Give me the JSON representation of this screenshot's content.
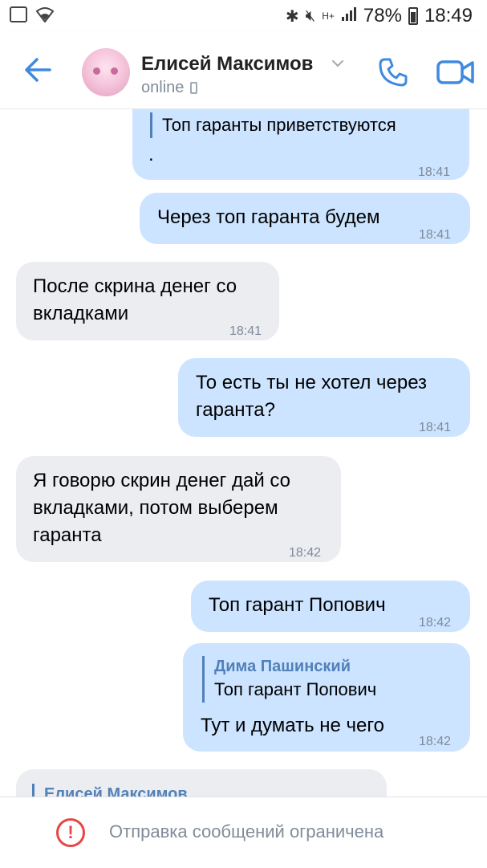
{
  "status_bar": {
    "battery": "78%",
    "time": "18:49",
    "signal": "H+"
  },
  "header": {
    "name": "Елисей Максимов",
    "status": "online"
  },
  "messages": [
    {
      "dir": "out",
      "quote_text": "Топ гаранты приветствуются",
      "text": ".",
      "time": "18:41"
    },
    {
      "dir": "out",
      "text": "Через топ гаранта будем",
      "time": "18:41"
    },
    {
      "dir": "in",
      "line1": "После скрина денег со",
      "line2": "вкладками",
      "time": "18:41"
    },
    {
      "dir": "out",
      "line1": "То есть ты не хотел через",
      "line2": "гаранта?",
      "time": "18:41"
    },
    {
      "dir": "in",
      "line1": "Я говорю скрин денег дай со",
      "line2": "вкладками, потом выберем",
      "line3": "гаранта",
      "time": "18:42"
    },
    {
      "dir": "out",
      "text": "Топ гарант Попович",
      "time": "18:42"
    },
    {
      "dir": "out",
      "quote_author": "Дима Пашинский",
      "quote_text": "Топ гарант Попович",
      "text": "Тут и думать не чего",
      "time": "18:42"
    },
    {
      "dir": "in",
      "quote_author": "Елисей Максимов"
    }
  ],
  "bottom_bar": {
    "warning": "Отправка сообщений ограничена"
  },
  "colors": {
    "accent": "#5181b8",
    "outgoing_bubble": "#cce4ff",
    "incoming_bubble": "#ebedf0",
    "warning": "#e64646"
  },
  "icons": [
    "image-icon",
    "wifi-icon",
    "bluetooth-icon",
    "mute-icon",
    "signal-icon",
    "battery-icon",
    "back-arrow-icon",
    "chevron-down-icon",
    "mobile-device-icon",
    "phone-icon",
    "video-call-icon",
    "warning-icon"
  ]
}
